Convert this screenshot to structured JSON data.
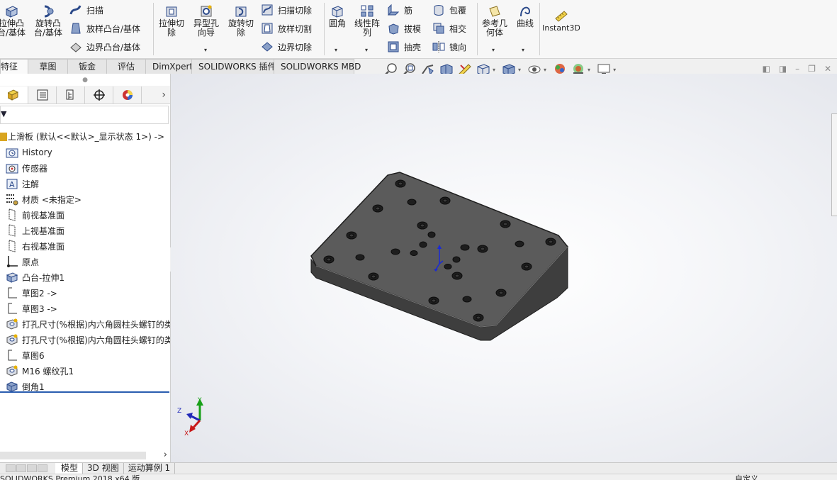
{
  "ribbon": {
    "extrude_boss": "拉伸凸\n台/基体",
    "revolve_boss": "旋转凸\n台/基体",
    "sweep": "扫描",
    "loft_boss": "放样凸台/基体",
    "boundary_boss": "边界凸台/基体",
    "extrude_cut": "拉伸切\n除",
    "hole_wizard": "异型孔\n向导",
    "revolve_cut": "旋转切\n除",
    "swept_cut": "扫描切除",
    "lofted_cut": "放样切割",
    "boundary_cut": "边界切除",
    "fillet": "圆角",
    "linear_pattern": "线性阵\n列",
    "rib": "筋",
    "draft": "拔模",
    "shell": "抽壳",
    "wrap": "包覆",
    "intersect": "相交",
    "mirror": "镜向",
    "ref_geometry": "参考几\n何体",
    "curves": "曲线",
    "instant3d": "Instant3D"
  },
  "cm_tabs": [
    "特征",
    "草图",
    "钣金",
    "评估",
    "DimXpert",
    "SOLIDWORKS 插件",
    "SOLIDWORKS MBD"
  ],
  "feature_tree": {
    "root": "上滑板 (默认<<默认>_显示状态 1>) ->",
    "items": [
      {
        "label": "History",
        "icon": "history-folder-icon"
      },
      {
        "label": "传感器",
        "icon": "sensors-icon"
      },
      {
        "label": "注解",
        "icon": "annotations-icon"
      },
      {
        "label": "材质 <未指定>",
        "icon": "material-icon"
      },
      {
        "label": "前视基准面",
        "icon": "plane-icon"
      },
      {
        "label": "上视基准面",
        "icon": "plane-icon"
      },
      {
        "label": "右视基准面",
        "icon": "plane-icon"
      },
      {
        "label": "原点",
        "icon": "origin-icon"
      },
      {
        "label": "凸台-拉伸1",
        "icon": "boss-extrude-icon"
      },
      {
        "label": "草图2 ->",
        "icon": "sketch-icon"
      },
      {
        "label": "草图3 ->",
        "icon": "sketch-icon"
      },
      {
        "label": "打孔尺寸(%根据)内六角圆柱头螺钉的类",
        "icon": "hole-wizard-icon"
      },
      {
        "label": "打孔尺寸(%根据)内六角圆柱头螺钉的类",
        "icon": "hole-wizard-icon"
      },
      {
        "label": "草图6",
        "icon": "sketch-icon"
      },
      {
        "label": "M16 螺纹孔1",
        "icon": "hole-wizard-icon"
      },
      {
        "label": "倒角1",
        "icon": "chamfer-icon"
      }
    ]
  },
  "triad": {
    "x": "X",
    "y": "Y",
    "z": "Z"
  },
  "bottom_tabs": [
    "模型",
    "3D 视图",
    "运动算例 1"
  ],
  "status": {
    "app": "SOLIDWORKS Premium 2018 x64 版",
    "units": "自定义"
  },
  "colors": {
    "part_top": "#5b5b5b",
    "part_side": "#3f3f3f",
    "hole": "#1e1e1e",
    "accent": "#2a5db0"
  }
}
